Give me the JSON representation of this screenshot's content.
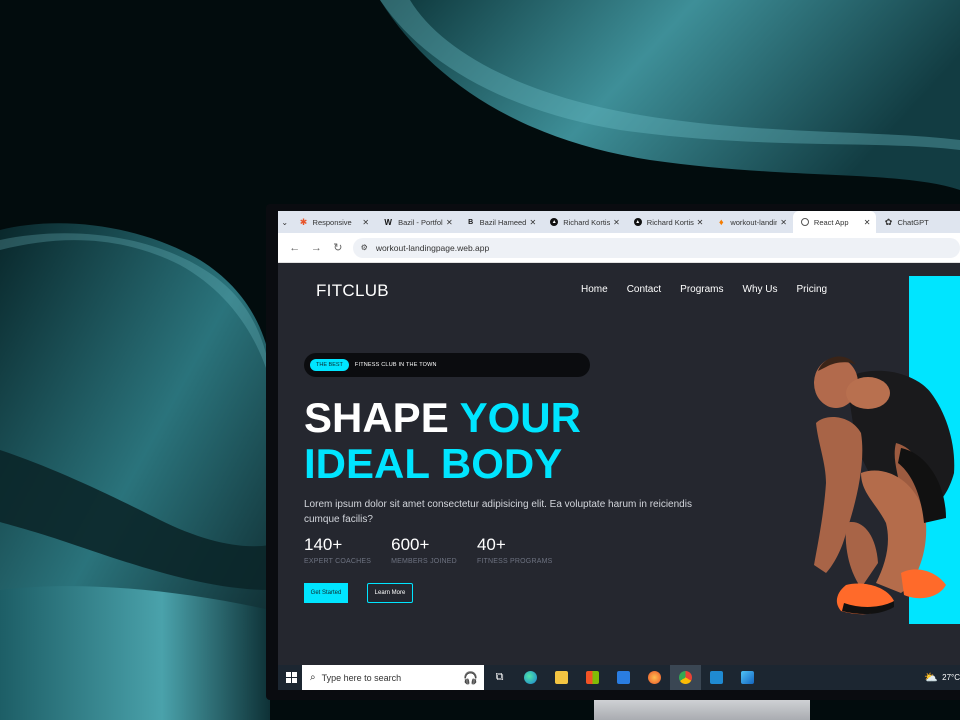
{
  "browser": {
    "tabs": [
      {
        "label": "Responsive",
        "favicon": "asterisk-icon",
        "color": "#e8542a"
      },
      {
        "label": "Bazil - Portfolio",
        "favicon": "w-icon",
        "color": "#222222"
      },
      {
        "label": "Bazil Hameed",
        "favicon": "b-icon",
        "color": "#222222"
      },
      {
        "label": "Richard Kortis",
        "favicon": "triangle-icon",
        "color": "#111111"
      },
      {
        "label": "Richard Kortis",
        "favicon": "triangle-icon",
        "color": "#111111"
      },
      {
        "label": "workout-landing",
        "favicon": "flame-icon",
        "color": "#f57c00"
      },
      {
        "label": "React App",
        "favicon": "globe-icon",
        "color": "#555555"
      },
      {
        "label": "ChatGPT",
        "favicon": "openai-icon",
        "color": "#333333"
      }
    ],
    "active_tab": 6,
    "url": "workout-landingpage.web.app"
  },
  "page": {
    "logo": "FITCLUB",
    "nav": [
      "Home",
      "Contact",
      "Programs",
      "Why Us",
      "Pricing"
    ],
    "badge": {
      "pill": "THE BEST",
      "text": "FITNESS CLUB IN THE TOWN"
    },
    "hero": {
      "line1_white": "SHAPE ",
      "line1_cyan": "YOUR",
      "line2_cyan": "IDEAL BODY"
    },
    "description": "Lorem ipsum dolor sit amet consectetur adipisicing elit. Ea voluptate harum in reiciendis cumque facilis?",
    "stats": [
      {
        "value": "140+",
        "label": "EXPERT COACHES"
      },
      {
        "value": "600+",
        "label": "MEMBERS JOINED"
      },
      {
        "value": "40+",
        "label": "FITNESS PROGRAMS"
      }
    ],
    "buttons": {
      "primary": "Get Started",
      "secondary": "Learn More"
    },
    "accent_color": "#00e5ff",
    "background_color": "#25272f"
  },
  "taskbar": {
    "search_placeholder": "Type here to search",
    "icons": [
      "task-view-icon",
      "edge-icon",
      "file-explorer-icon",
      "store-icon",
      "mail-icon",
      "firefox-icon",
      "chrome-icon",
      "vscode-icon",
      "photos-icon"
    ],
    "temperature": "27°C"
  }
}
